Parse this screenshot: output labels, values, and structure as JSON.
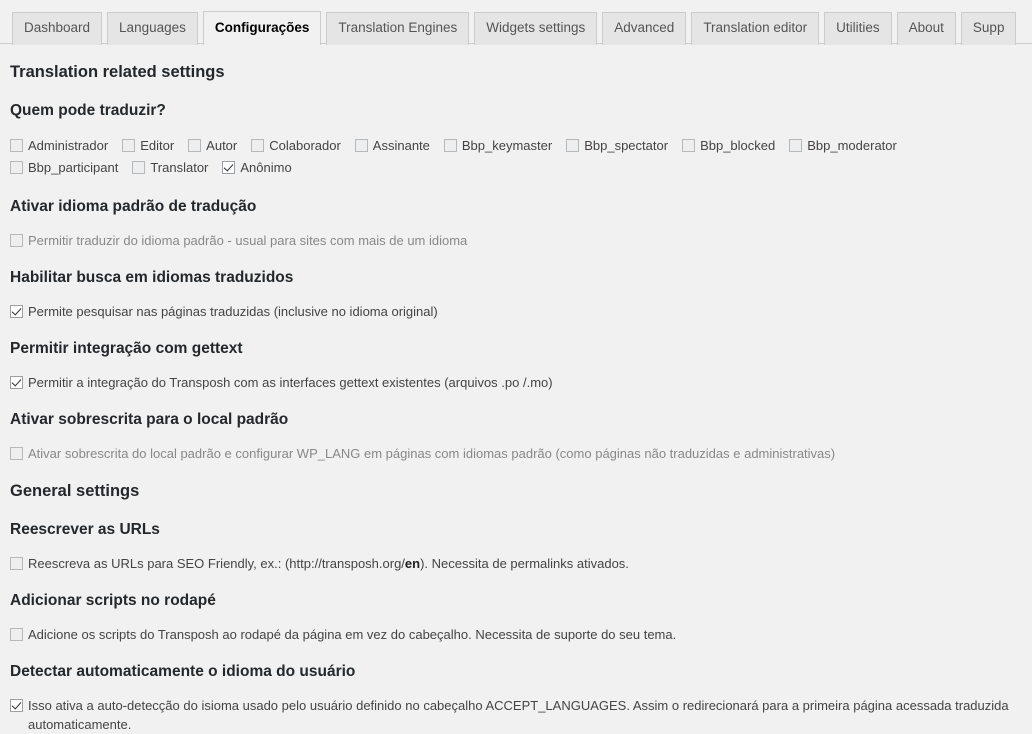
{
  "tabs": [
    {
      "label": "Dashboard",
      "active": false
    },
    {
      "label": "Languages",
      "active": false
    },
    {
      "label": "Configurações",
      "active": true
    },
    {
      "label": "Translation Engines",
      "active": false
    },
    {
      "label": "Widgets settings",
      "active": false
    },
    {
      "label": "Advanced",
      "active": false
    },
    {
      "label": "Translation editor",
      "active": false
    },
    {
      "label": "Utilities",
      "active": false
    },
    {
      "label": "About",
      "active": false
    },
    {
      "label": "Supp",
      "active": false
    }
  ],
  "sections": {
    "translation_related": {
      "title": "Translation related settings",
      "who_can_translate": {
        "title": "Quem pode traduzir?",
        "roles": [
          {
            "label": "Administrador",
            "checked": false
          },
          {
            "label": "Editor",
            "checked": false
          },
          {
            "label": "Autor",
            "checked": false
          },
          {
            "label": "Colaborador",
            "checked": false
          },
          {
            "label": "Assinante",
            "checked": false
          },
          {
            "label": "Bbp_keymaster",
            "checked": false
          },
          {
            "label": "Bbp_spectator",
            "checked": false
          },
          {
            "label": "Bbp_blocked",
            "checked": false
          },
          {
            "label": "Bbp_moderator",
            "checked": false
          },
          {
            "label": "Bbp_participant",
            "checked": false
          },
          {
            "label": "Translator",
            "checked": false
          },
          {
            "label": "Anônimo",
            "checked": true
          }
        ]
      },
      "default_language": {
        "title": "Ativar idioma padrão de tradução",
        "option_label": "Permitir traduzir do idioma padrão - usual para sites com mais de um idioma",
        "checked": false
      },
      "search_translated": {
        "title": "Habilitar busca em idiomas traduzidos",
        "option_label": "Permite pesquisar nas páginas traduzidas (inclusive no idioma original)",
        "checked": true
      },
      "gettext": {
        "title": "Permitir integração com gettext",
        "option_label": "Permitir a integração do Transposh com as interfaces gettext existentes (arquivos .po /.mo)",
        "checked": true
      },
      "locale_override": {
        "title": "Ativar sobrescrita para o local padrão",
        "option_label": "Ativar sobrescrita do local padrão e configurar WP_LANG em páginas com idiomas padrão (como páginas não traduzidas e administrativas)",
        "checked": false
      }
    },
    "general": {
      "title": "General settings",
      "rewrite_urls": {
        "title": "Reescrever as URLs",
        "option_prefix": "Reescreva as URLs para SEO Friendly, ex.: (http://transposh.org/",
        "option_bold": "en",
        "option_suffix": "). Necessita de permalinks ativados.",
        "checked": false
      },
      "footer_scripts": {
        "title": "Adicionar scripts no rodapé",
        "option_label": "Adicione os scripts do Transposh ao rodapé da página em vez do cabeçalho. Necessita de suporte do seu tema.",
        "checked": false
      },
      "auto_detect": {
        "title": "Detectar automaticamente o idioma do usuário",
        "option_label": "Isso ativa a auto-detecção do isioma usado pelo usuário definido no cabeçalho ACCEPT_LANGUAGES. Assim o redirecionará para a primeira página acessada traduzida automaticamente.",
        "checked": true
      }
    }
  }
}
